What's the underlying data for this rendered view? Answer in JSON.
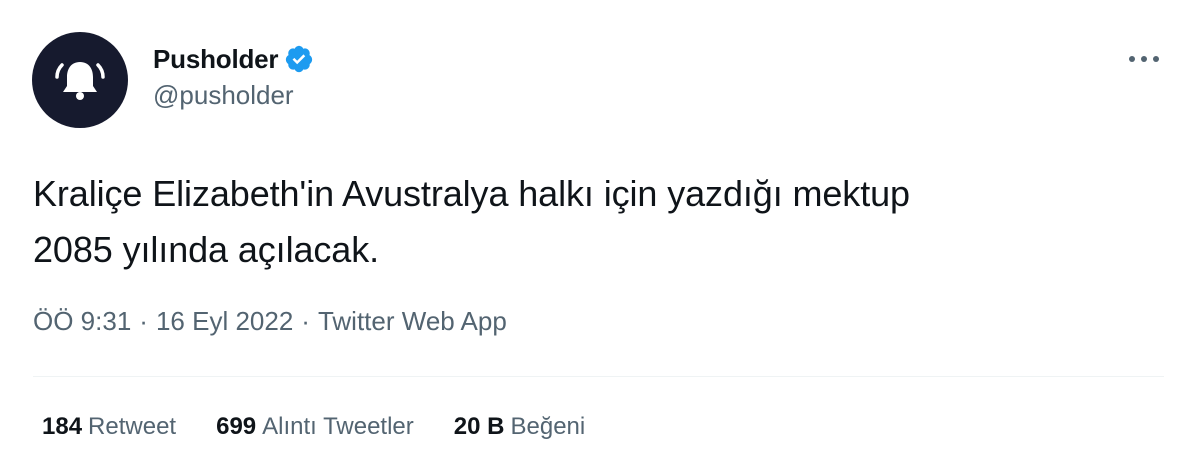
{
  "user": {
    "display_name": "Pusholder",
    "handle": "@pusholder",
    "avatar_icon": "bell-icon",
    "avatar_bg": "#161a2e",
    "verified": true,
    "verified_color": "#1d9bf0"
  },
  "more_icon": "more-horizontal-icon",
  "tweet": {
    "text_line1": "Kraliçe Elizabeth'in Avustralya halkı için yazdığı mektup",
    "text_line2": "2085 yılında açılacak."
  },
  "meta": {
    "time": "ÖÖ 9:31",
    "separator": "·",
    "date": "16 Eyl 2022",
    "source": "Twitter Web App"
  },
  "stats": {
    "retweets": {
      "count": "184",
      "label": "Retweet"
    },
    "quotes": {
      "count": "699",
      "label": "Alıntı Tweetler"
    },
    "likes": {
      "count": "20 B",
      "label": "Beğeni"
    }
  }
}
